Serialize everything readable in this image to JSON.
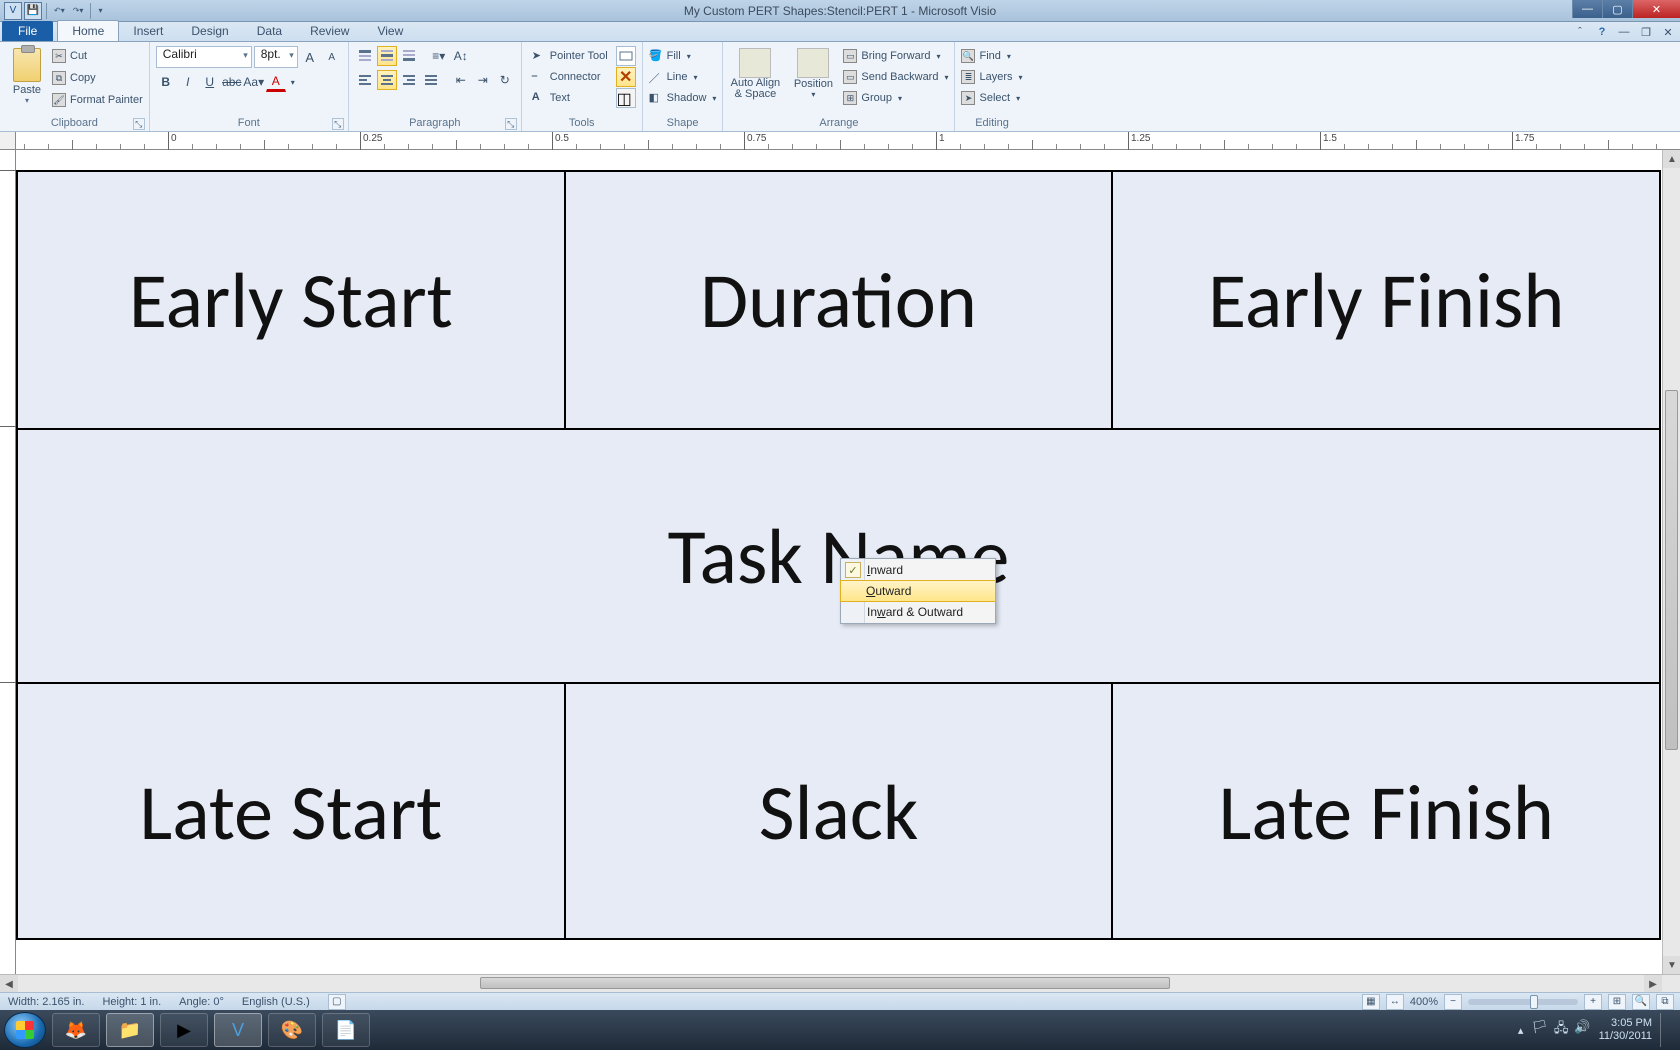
{
  "title": "My Custom PERT Shapes:Stencil:PERT 1 - Microsoft Visio",
  "tabs": {
    "file": "File",
    "home": "Home",
    "insert": "Insert",
    "design": "Design",
    "data": "Data",
    "review": "Review",
    "view": "View"
  },
  "ribbon": {
    "clipboard": {
      "label": "Clipboard",
      "paste": "Paste",
      "cut": "Cut",
      "copy": "Copy",
      "format_painter": "Format Painter"
    },
    "font": {
      "label": "Font",
      "name": "Calibri",
      "size": "8pt."
    },
    "paragraph": {
      "label": "Paragraph"
    },
    "tools": {
      "label": "Tools",
      "pointer": "Pointer Tool",
      "connector": "Connector",
      "text": "Text"
    },
    "shape": {
      "label": "Shape",
      "fill": "Fill",
      "line": "Line",
      "shadow": "Shadow"
    },
    "arrange": {
      "label": "Arrange",
      "autoalign": "Auto Align & Space",
      "position": "Position",
      "bring_forward": "Bring Forward",
      "send_backward": "Send Backward",
      "group": "Group"
    },
    "editing": {
      "label": "Editing",
      "find": "Find",
      "layers": "Layers",
      "select": "Select"
    }
  },
  "ruler": {
    "marks": [
      "0",
      "0.25",
      "0.5",
      "0.75",
      "1",
      "1.25",
      "1.5",
      "1.75"
    ]
  },
  "pert": {
    "early_start": "Early Start",
    "duration": "Duration",
    "early_finish": "Early Finish",
    "task_name": "Task Name",
    "late_start": "Late Start",
    "slack": "Slack",
    "late_finish": "Late Finish"
  },
  "context_menu": {
    "inward": "Inward",
    "outward": "Outward",
    "both": "Inward & Outward"
  },
  "status": {
    "width": "Width: 2.165 in.",
    "height": "Height: 1 in.",
    "angle": "Angle: 0°",
    "lang": "English (U.S.)",
    "zoom": "400%"
  },
  "tray": {
    "time": "3:05 PM",
    "date": "11/30/2011"
  }
}
